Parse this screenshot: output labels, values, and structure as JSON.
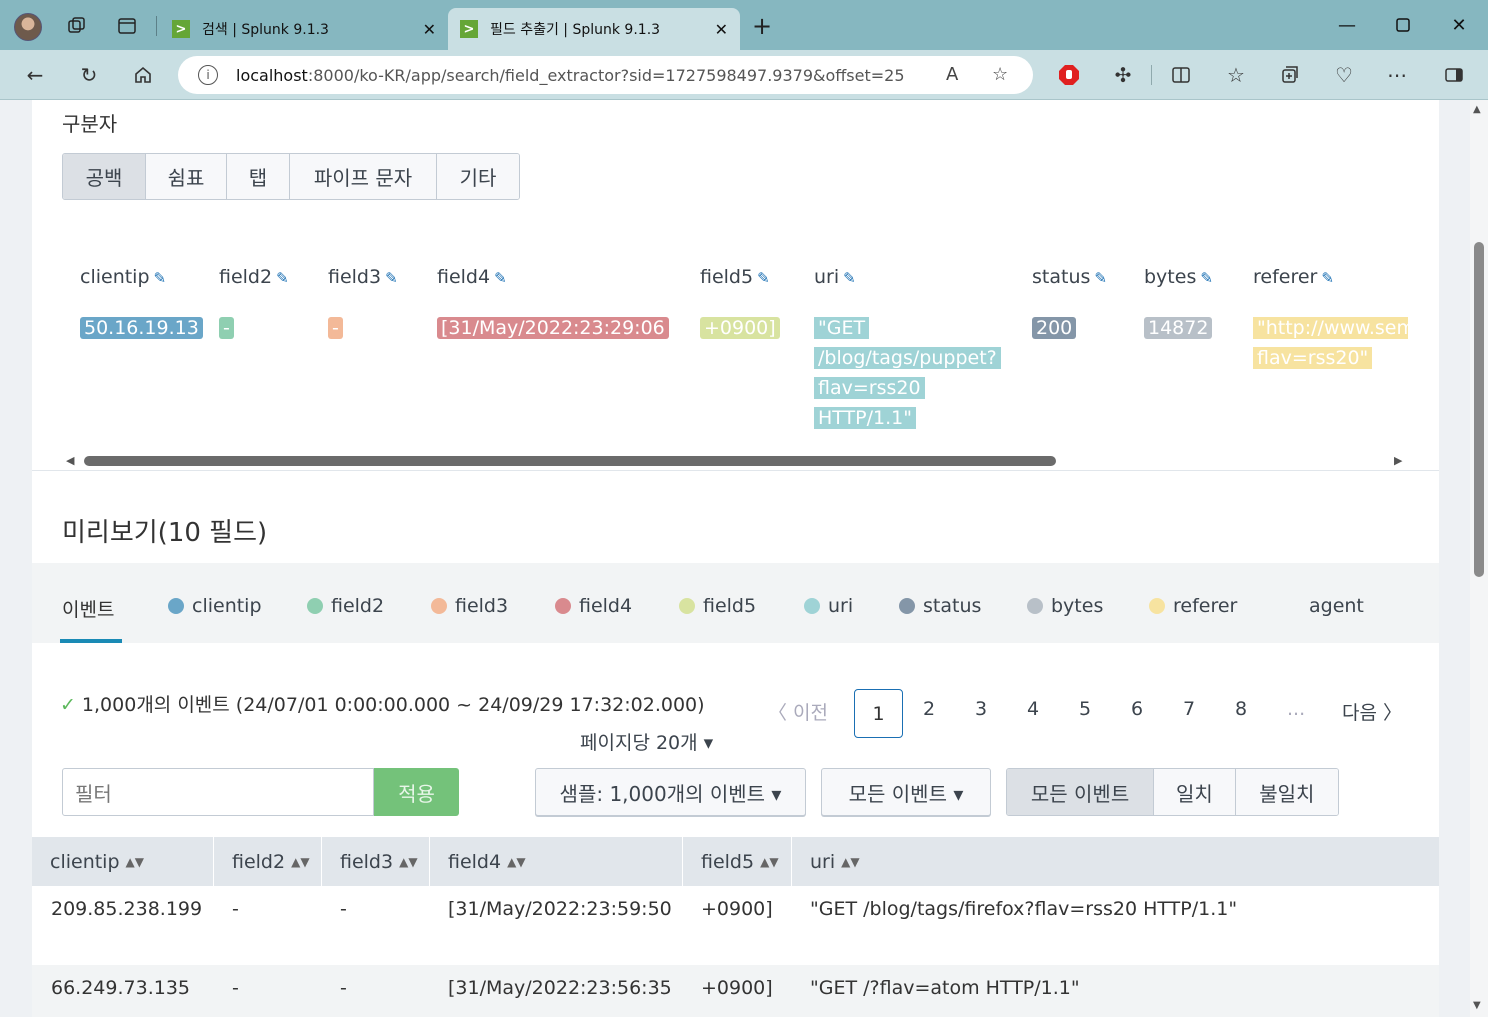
{
  "browser": {
    "tabs": [
      {
        "title": "검색 | Splunk 9.1.3",
        "active": false
      },
      {
        "title": "필드 추출기 | Splunk 9.1.3",
        "active": true
      }
    ],
    "url_host": "localhost",
    "url_path": ":8000/ko-KR/app/search/field_extractor?sid=1727598497.9379&offset=25",
    "favicon_glyph": ">",
    "new_tab_glyph": "+"
  },
  "delimiter": {
    "label": "구분자",
    "options": [
      {
        "label": "공백",
        "selected": true
      },
      {
        "label": "쉼표",
        "selected": false
      },
      {
        "label": "탭",
        "selected": false
      },
      {
        "label": "파이프 문자",
        "selected": false
      },
      {
        "label": "기타",
        "selected": false
      }
    ]
  },
  "fields": [
    {
      "name": "clientip",
      "value": [
        "50.16.19.13"
      ],
      "color": "#6aa6c8"
    },
    {
      "name": "field2",
      "value": [
        "-"
      ],
      "color": "#8fcfb1"
    },
    {
      "name": "field3",
      "value": [
        "-"
      ],
      "color": "#f3b998"
    },
    {
      "name": "field4",
      "value": [
        "[31/May/2022:23:29:06"
      ],
      "color": "#d98a8e"
    },
    {
      "name": "field5",
      "value": [
        "+0900]"
      ],
      "color": "#d8e3a0"
    },
    {
      "name": "uri",
      "value": [
        "\"GET",
        "/blog/tags/puppet?",
        "flav=rss20",
        "HTTP/1.1\""
      ],
      "color": "#9fd3d6"
    },
    {
      "name": "status",
      "value": [
        "200"
      ],
      "color": "#8496a8"
    },
    {
      "name": "bytes",
      "value": [
        "14872"
      ],
      "color": "#b8c0c8"
    },
    {
      "name": "referer",
      "value": [
        "\"http://www.sem",
        "flav=rss20\""
      ],
      "color": "#f7e3a0"
    }
  ],
  "preview": {
    "title": "미리보기(10 필드)",
    "tabs": [
      {
        "label": "이벤트",
        "color": ""
      },
      {
        "label": "clientip",
        "color": "#6aa6c8"
      },
      {
        "label": "field2",
        "color": "#8fcfb1"
      },
      {
        "label": "field3",
        "color": "#f3b998"
      },
      {
        "label": "field4",
        "color": "#d98a8e"
      },
      {
        "label": "field5",
        "color": "#d8e3a0"
      },
      {
        "label": "uri",
        "color": "#9fd3d6"
      },
      {
        "label": "status",
        "color": "#8496a8"
      },
      {
        "label": "bytes",
        "color": "#b8c0c8"
      },
      {
        "label": "referer",
        "color": "#f7e3a0"
      },
      {
        "label": "agent",
        "color": ""
      }
    ],
    "count_text": "1,000개의 이벤트 (24/07/01 0:00:00.000 ~ 24/09/29 17:32:02.000)",
    "per_page": "페이지당 20개 ▾",
    "pager": {
      "prev": "〈 이전",
      "pages": [
        "1",
        "2",
        "3",
        "4",
        "5",
        "6",
        "7",
        "8",
        "..."
      ],
      "current": "1",
      "next": "다음 〉"
    },
    "filter_placeholder": "필터",
    "apply_label": "적용",
    "sample_label": "샘플: 1,000개의 이벤트 ▾",
    "all_events_dd": "모든 이벤트 ▾",
    "match_options": [
      "모든 이벤트",
      "일치",
      "불일치"
    ],
    "table": {
      "columns": [
        "clientip",
        "field2",
        "field3",
        "field4",
        "field5",
        "uri"
      ],
      "rows": [
        [
          "209.85.238.199",
          "-",
          "-",
          "[31/May/2022:23:59:50",
          "+0900]",
          "\"GET /blog/tags/firefox?flav=rss20 HTTP/1.1\""
        ],
        [
          "66.249.73.135",
          "-",
          "-",
          "[31/May/2022:23:56:35",
          "+0900]",
          "\"GET /?flav=atom HTTP/1.1\""
        ]
      ]
    }
  }
}
